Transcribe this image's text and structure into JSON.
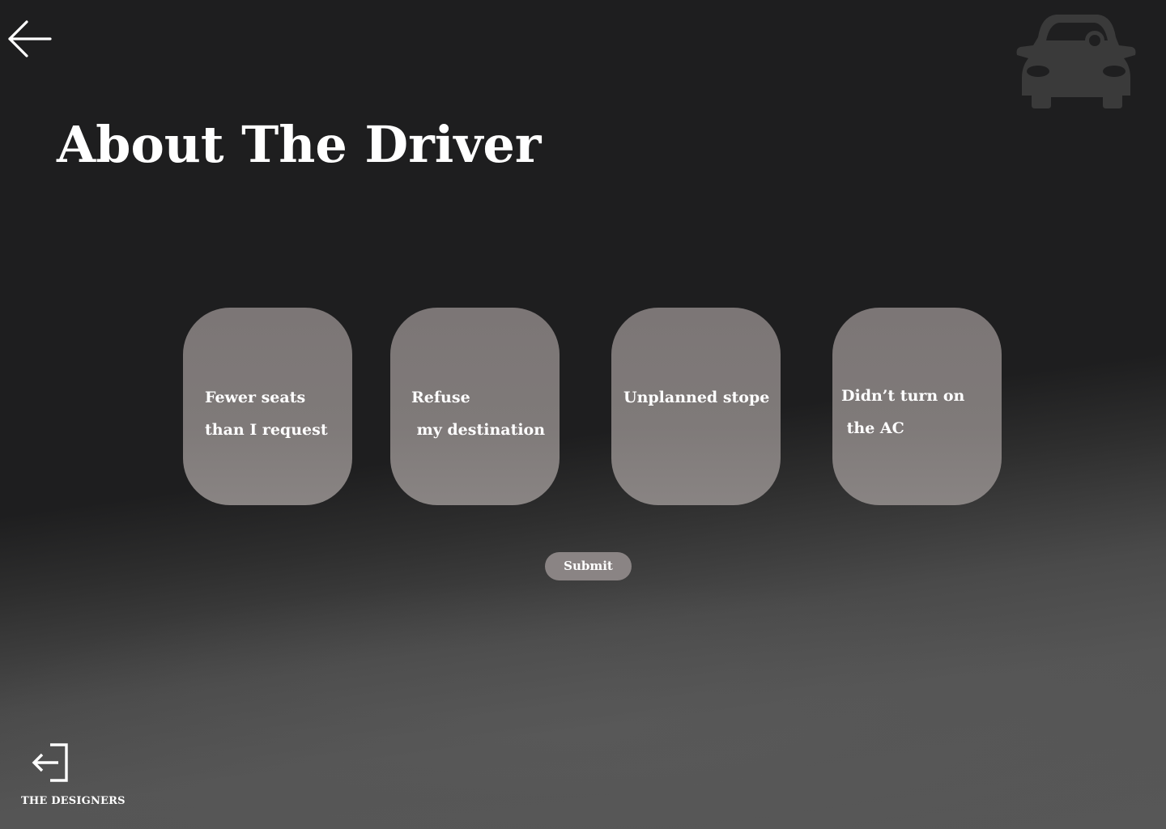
{
  "page": {
    "title": "About The Driver"
  },
  "header": {
    "back_icon": "arrow-left-icon",
    "car_icon": "car-icon",
    "car_icon_color": "#3a3a3a"
  },
  "options": [
    {
      "label": "Fewer seats \nthan I request"
    },
    {
      "label": "Refuse\n my destination"
    },
    {
      "label": "Unplanned stope"
    },
    {
      "label": "Didn’t turn on\n the AC"
    }
  ],
  "actions": {
    "submit_label": "Submit"
  },
  "footer": {
    "logout_icon": "logout-icon",
    "brand": "THE DESIGNERS"
  },
  "colors": {
    "background_dark": "#1e1e1f",
    "background_light": "#575757",
    "card": "#7f7a79",
    "button": "#8a8484",
    "text": "#ffffff"
  }
}
